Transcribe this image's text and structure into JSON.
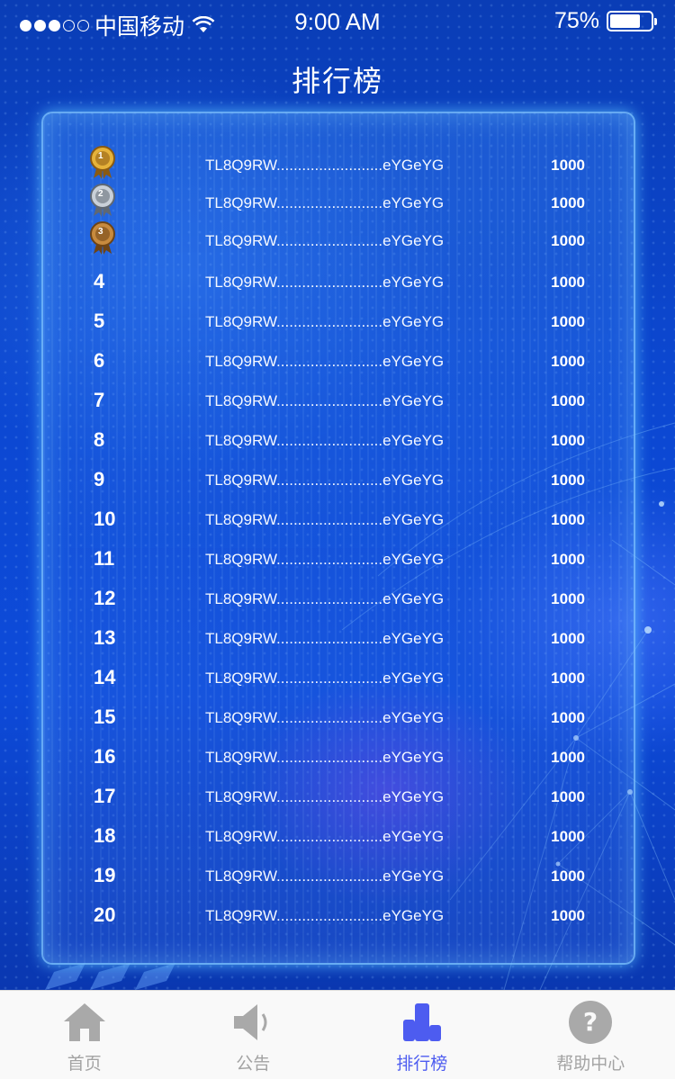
{
  "status_bar": {
    "carrier": "中国移动",
    "time": "9:00 AM",
    "battery_text": "75%",
    "battery_level": 0.75,
    "signal_bars": 3
  },
  "header": {
    "title": "排行榜"
  },
  "ranking": {
    "rows": [
      {
        "rank": "1",
        "medal": "gold",
        "address": "TL8Q9RW.........................eYGeYG",
        "score": "1000"
      },
      {
        "rank": "2",
        "medal": "silver",
        "address": "TL8Q9RW.........................eYGeYG",
        "score": "1000"
      },
      {
        "rank": "3",
        "medal": "bronze",
        "address": "TL8Q9RW.........................eYGeYG",
        "score": "1000"
      },
      {
        "rank": "4",
        "address": "TL8Q9RW.........................eYGeYG",
        "score": "1000"
      },
      {
        "rank": "5",
        "address": "TL8Q9RW.........................eYGeYG",
        "score": "1000"
      },
      {
        "rank": "6",
        "address": "TL8Q9RW.........................eYGeYG",
        "score": "1000"
      },
      {
        "rank": "7",
        "address": "TL8Q9RW.........................eYGeYG",
        "score": "1000"
      },
      {
        "rank": "8",
        "address": "TL8Q9RW.........................eYGeYG",
        "score": "1000"
      },
      {
        "rank": "9",
        "address": "TL8Q9RW.........................eYGeYG",
        "score": "1000"
      },
      {
        "rank": "10",
        "address": "TL8Q9RW.........................eYGeYG",
        "score": "1000"
      },
      {
        "rank": "11",
        "address": "TL8Q9RW.........................eYGeYG",
        "score": "1000"
      },
      {
        "rank": "12",
        "address": "TL8Q9RW.........................eYGeYG",
        "score": "1000"
      },
      {
        "rank": "13",
        "address": "TL8Q9RW.........................eYGeYG",
        "score": "1000"
      },
      {
        "rank": "14",
        "address": "TL8Q9RW.........................eYGeYG",
        "score": "1000"
      },
      {
        "rank": "15",
        "address": "TL8Q9RW.........................eYGeYG",
        "score": "1000"
      },
      {
        "rank": "16",
        "address": "TL8Q9RW.........................eYGeYG",
        "score": "1000"
      },
      {
        "rank": "17",
        "address": "TL8Q9RW.........................eYGeYG",
        "score": "1000"
      },
      {
        "rank": "18",
        "address": "TL8Q9RW.........................eYGeYG",
        "score": "1000"
      },
      {
        "rank": "19",
        "address": "TL8Q9RW.........................eYGeYG",
        "score": "1000"
      },
      {
        "rank": "20",
        "address": "TL8Q9RW.........................eYGeYG",
        "score": "1000"
      }
    ]
  },
  "tab_bar": {
    "tabs": [
      {
        "label": "首页",
        "icon": "home-icon",
        "active": false
      },
      {
        "label": "公告",
        "icon": "speaker-icon",
        "active": false
      },
      {
        "label": "排行榜",
        "icon": "ranking-icon",
        "active": true
      },
      {
        "label": "帮助中心",
        "icon": "help-icon",
        "active": false
      }
    ],
    "active_color": "#4d5cf0",
    "inactive_color": "#a3a3a3"
  },
  "colors": {
    "background": "#0b3fc4",
    "panel_border": "#82c8ff",
    "gold": "#c8922a",
    "silver": "#9aa3ad",
    "bronze": "#a8702c"
  }
}
